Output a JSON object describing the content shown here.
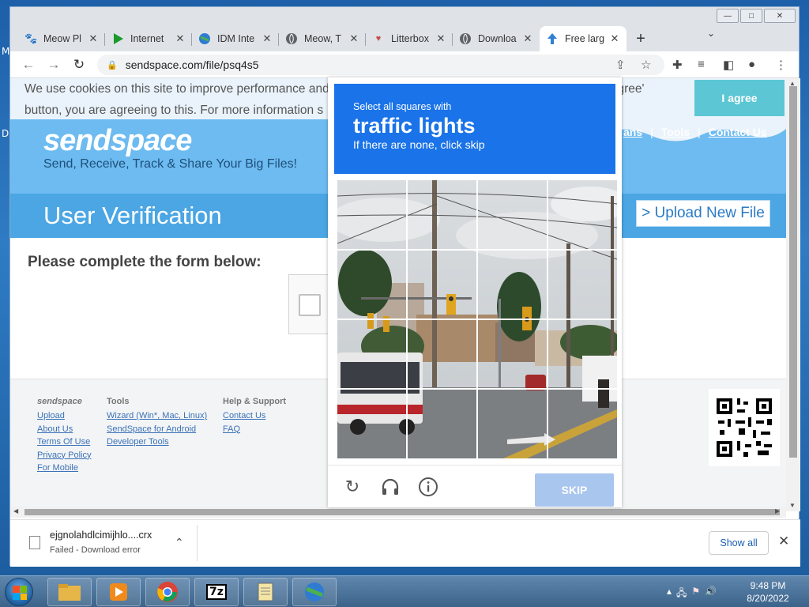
{
  "desktop": {
    "label_top": "M",
    "label_mid": "D"
  },
  "window": {
    "minimize": "—",
    "maximize": "□",
    "close": "✕"
  },
  "tabs": [
    {
      "label": "Meow Pl",
      "icon": "paw-icon"
    },
    {
      "label": "Internet",
      "icon": "play-icon"
    },
    {
      "label": "IDM Inte",
      "icon": "idm-icon"
    },
    {
      "label": "Meow, T",
      "icon": "globe-icon"
    },
    {
      "label": "Litterbox",
      "icon": "litterbox-icon"
    },
    {
      "label": "Downloa",
      "icon": "globe-icon"
    },
    {
      "label": "Free larg",
      "icon": "upload-arrow-icon"
    }
  ],
  "new_tab": "+",
  "address_bar": {
    "url": "sendspace.com/file/psq4s5"
  },
  "cookie_banner": {
    "text_line1": "We use cookies on this site to improve performance and for analytics. By browsing this site, or clicking the 'I agree'",
    "text_line2": "button, you are agreeing to this. For more information s",
    "agree": "I agree"
  },
  "site": {
    "logo": "sendspace",
    "tagline": "Send, Receive, Track & Share Your Big Files!",
    "nav": [
      "ans",
      "Tools",
      "Contact Us"
    ],
    "page_title": "User Verification",
    "upload_button": "> Upload New File",
    "form_title": "Please complete the form below:"
  },
  "footer": {
    "col1": {
      "head": "sendspace",
      "links": [
        "Upload",
        "About Us",
        "Terms Of Use",
        "Privacy Policy",
        "For Mobile"
      ]
    },
    "col2": {
      "head": "Tools",
      "links": [
        "Wizard (Win*, Mac, Linux)",
        "SendSpace for Android",
        "Developer Tools"
      ]
    },
    "col3": {
      "head": "Help & Support",
      "links": [
        "Contact Us",
        "FAQ"
      ]
    }
  },
  "captcha": {
    "instruction": "Select all squares with",
    "target": "traffic lights",
    "hint": "If there are none, click skip",
    "skip": "SKIP",
    "colors": {
      "header": "#1a73e8",
      "skip_bg": "#a9c6ee"
    }
  },
  "download": {
    "filename": "ejgnolahdlcimijhlo....crx",
    "status": "Failed - Download error",
    "show_all": "Show all"
  },
  "taskbar": {
    "time": "9:48 PM",
    "date": "8/20/2022",
    "app_7z": "7z"
  }
}
